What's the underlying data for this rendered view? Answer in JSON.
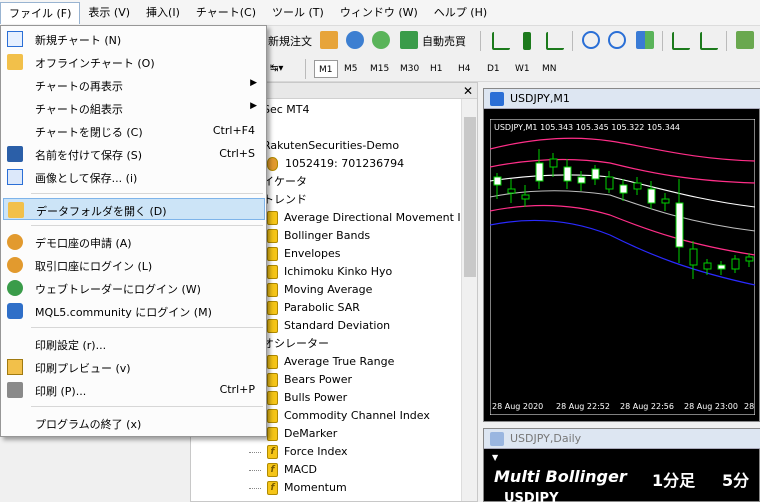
{
  "menubar": {
    "items": [
      "ファイル (F)",
      "表示 (V)",
      "挿入(I)",
      "チャート(C)",
      "ツール (T)",
      "ウィンドウ (W)",
      "ヘルプ (H)"
    ],
    "active_index": 0
  },
  "toolbar": {
    "new_order": "新規注文",
    "auto_trade": "自動売買",
    "timeframes": [
      "M1",
      "M5",
      "M15",
      "M30",
      "H1",
      "H4",
      "D1",
      "W1",
      "MN"
    ],
    "selected_timeframe": "M1"
  },
  "navigator": {
    "header_partial": "Sec MT4",
    "server": "RakutenSecurities-Demo",
    "account": "1052419: 701236794",
    "indicators_partial": "イケータ",
    "trend_partial": "トレンド",
    "trend_items": [
      "Average Directional Movement In",
      "Bollinger Bands",
      "Envelopes",
      "Ichimoku Kinko Hyo",
      "Moving Average",
      "Parabolic SAR",
      "Standard Deviation"
    ],
    "oscillators_partial": "オシレーター",
    "osc_items": [
      "Average True Range",
      "Bears Power",
      "Bulls Power",
      "Commodity Channel Index",
      "DeMarker",
      "Force Index",
      "MACD",
      "Momentum"
    ]
  },
  "chart1": {
    "title": "USDJPY,M1",
    "info": "USDJPY,M1  105.343 105.345 105.322 105.344",
    "time_labels": [
      "28 Aug 2020",
      "28 Aug 22:52",
      "28 Aug 22:56",
      "28 Aug 23:00",
      "28"
    ]
  },
  "chart2": {
    "title": "USDJPY,Daily",
    "overlay_title": "Multi Bollinger",
    "overlay_tf1": "1分足",
    "overlay_tf2": "5分",
    "overlay_symbol": "USDJPY"
  },
  "file_menu": {
    "items": [
      {
        "label": "新規チャート (N)",
        "shortcut": "",
        "icon": "new-chart-icon",
        "submenu": false
      },
      {
        "label": "オフラインチャート (O)",
        "shortcut": "",
        "icon": "folder-open-icon",
        "submenu": false
      },
      {
        "label": "チャートの再表示",
        "shortcut": "",
        "icon": "",
        "submenu": true
      },
      {
        "label": "チャートの組表示",
        "shortcut": "",
        "icon": "",
        "submenu": true
      },
      {
        "label": "チャートを閉じる (C)",
        "shortcut": "Ctrl+F4",
        "icon": "",
        "submenu": false
      },
      {
        "label": "名前を付けて保存 (S)",
        "shortcut": "Ctrl+S",
        "icon": "save-icon",
        "submenu": false
      },
      {
        "label": "画像として保存... (i)",
        "shortcut": "",
        "icon": "save-image-icon",
        "submenu": false
      },
      {
        "label": "データフォルダを開く (D)",
        "shortcut": "",
        "icon": "data-folder-icon",
        "submenu": false
      },
      {
        "label": "デモ口座の申請 (A)",
        "shortcut": "",
        "icon": "demo-account-icon",
        "submenu": false
      },
      {
        "label": "取引口座にログイン (L)",
        "shortcut": "",
        "icon": "login-icon",
        "submenu": false
      },
      {
        "label": "ウェブトレーダーにログイン (W)",
        "shortcut": "",
        "icon": "web-trader-icon",
        "submenu": false
      },
      {
        "label": "MQL5.community にログイン (M)",
        "shortcut": "",
        "icon": "mql5-icon",
        "submenu": false
      },
      {
        "label": "印刷設定 (r)...",
        "shortcut": "",
        "icon": "",
        "submenu": false
      },
      {
        "label": "印刷プレビュー (v)",
        "shortcut": "",
        "icon": "print-preview-icon",
        "submenu": false
      },
      {
        "label": "印刷 (P)...",
        "shortcut": "Ctrl+P",
        "icon": "print-icon",
        "submenu": false
      },
      {
        "label": "プログラムの終了 (x)",
        "shortcut": "",
        "icon": "",
        "submenu": false
      }
    ],
    "highlighted_index": 7
  },
  "colors": {
    "bb_pink": "#ff2e88",
    "bb_white": "#ffffff",
    "bb_gray": "#bdbdbd",
    "bb_blue": "#2a2aff",
    "candle_green": "#00d000",
    "menu_highlight": "#cce4f7"
  }
}
